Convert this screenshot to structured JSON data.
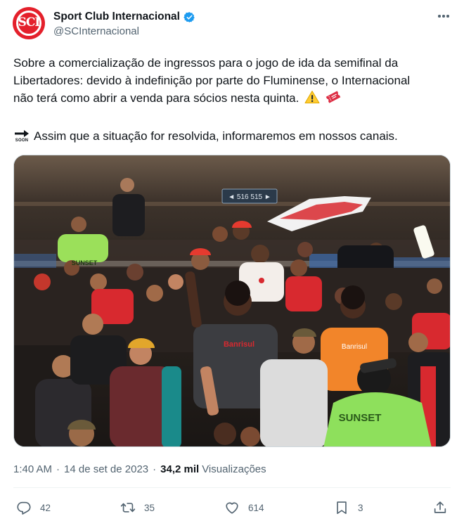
{
  "author": {
    "display_name": "Sport Club Internacional",
    "handle": "@SCInternacional",
    "avatar_initials": "SCI",
    "verified": true,
    "verified_color": "#1d9bf0",
    "brand_color": "#e4202b"
  },
  "tweet": {
    "lines": [
      "Sobre a comercialização de ingressos para o jogo de ida da semifinal da",
      "Libertadores: devido à indefinição por parte do Fluminense, o Internacional",
      "não terá como abrir a venda para sócios nesta quinta."
    ],
    "second_paragraph": "Assim que a situação for resolvida, informaremos em nossos canais.",
    "soon_label": "SOON",
    "emojis": [
      "warning-emoji",
      "ticket-emoji"
    ]
  },
  "photo": {
    "banner_text": "◄ 516 515 ►",
    "sponsor_text": "Banrisul",
    "staff_vest_text": "SUNSET",
    "staff_vest_text_small": "SUNSET"
  },
  "meta": {
    "time": "1:40 AM",
    "date": "14 de set de 2023",
    "views_count": "34,2 mil",
    "views_label": "Visualizações"
  },
  "actions": {
    "replies": "42",
    "retweets": "35",
    "likes": "614",
    "bookmarks": "3"
  }
}
